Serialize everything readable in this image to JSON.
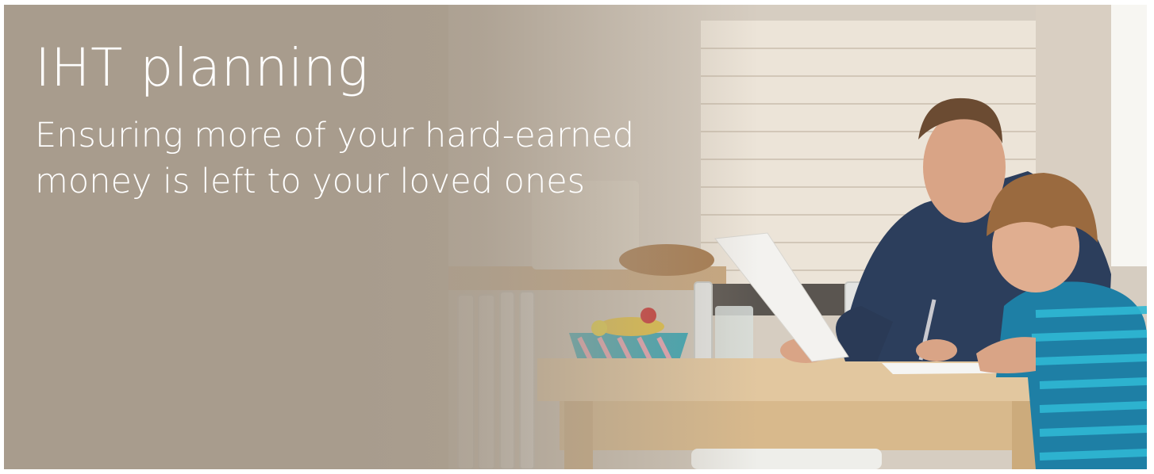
{
  "hero": {
    "title": "IHT planning",
    "subtitle": "Ensuring more of your hard-earned money is left to your loved ones"
  },
  "colors": {
    "overlay": "#a89c8d",
    "text": "#ffffff",
    "table_wood": "#e2c79f",
    "shirt_blue": "#2c3e5c",
    "stripe_teal": "#1ea6c0"
  }
}
